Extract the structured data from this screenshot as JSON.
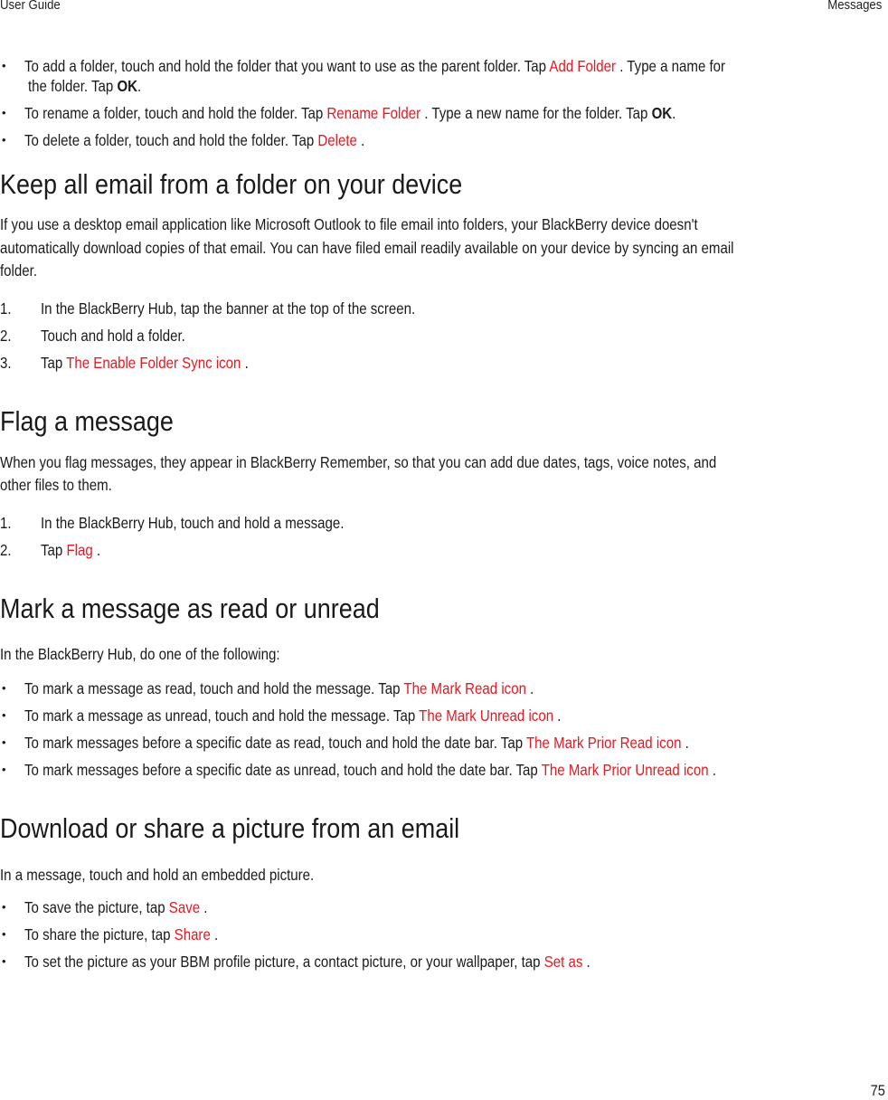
{
  "header": {
    "left": "User Guide",
    "right": "Messages"
  },
  "folder_bullets": [
    {
      "line1_pre": "To add a folder, touch and hold the folder that you want to use as the parent folder. Tap ",
      "link": "Add Folder",
      "line1_post": " . Type a name for",
      "line2_pre": "the folder. Tap ",
      "line2_bold": "OK",
      "line2_post": "."
    },
    {
      "pre": "To rename a folder, touch and hold the folder. Tap ",
      "link": "Rename Folder",
      "post": " . Type a new name for the folder. Tap ",
      "bold": "OK",
      "end": "."
    },
    {
      "pre": "To delete a folder, touch and hold the folder. Tap ",
      "link": "Delete",
      "post": " ."
    }
  ],
  "sections": {
    "keep": {
      "title": "Keep all email from a folder on your device",
      "para": [
        "If you use a desktop email application like Microsoft Outlook to file email into folders, your BlackBerry device doesn't",
        "automatically download copies of that email. You can have filed email readily available on your device by syncing an email",
        "folder."
      ],
      "steps": [
        {
          "num": "1.",
          "text": "In the BlackBerry Hub, tap the banner at the top of the screen."
        },
        {
          "num": "2.",
          "text": "Touch and hold a folder."
        },
        {
          "num": "3.",
          "pre": "Tap ",
          "link": "The Enable Folder Sync icon",
          "post": " ."
        }
      ]
    },
    "flag": {
      "title": "Flag a message",
      "para": [
        "When you flag messages, they appear in BlackBerry Remember, so that you can add due dates, tags, voice notes, and",
        "other files to them."
      ],
      "steps": [
        {
          "num": "1.",
          "text": "In the BlackBerry Hub, touch and hold a message."
        },
        {
          "num": "2.",
          "pre": "Tap ",
          "link": "Flag",
          "post": " ."
        }
      ]
    },
    "mark": {
      "title": "Mark a message as read or unread",
      "intro": "In the BlackBerry Hub, do one of the following:",
      "bullets": [
        {
          "pre": "To mark a message as read, touch and hold the message. Tap ",
          "link": "The Mark Read icon",
          "post": " ."
        },
        {
          "pre": "To mark a message as unread, touch and hold the message. Tap ",
          "link": "The Mark Unread icon",
          "post": " ."
        },
        {
          "pre": "To mark messages before a specific date as read, touch and hold the date bar. Tap ",
          "link": "The Mark Prior Read icon",
          "post": " ."
        },
        {
          "pre": "To mark messages before a specific date as unread, touch and hold the date bar. Tap ",
          "link": "The Mark Prior Unread icon",
          "post": " ."
        }
      ]
    },
    "picture": {
      "title": "Download or share a picture from an email",
      "intro": "In a message, touch and hold an embedded picture.",
      "bullets": [
        {
          "pre": "To save the picture, tap ",
          "link": "Save",
          "post": " ."
        },
        {
          "pre": "To share the picture, tap ",
          "link": "Share",
          "post": " ."
        },
        {
          "pre": "To set the picture as your BBM profile picture, a contact picture, or your wallpaper, tap ",
          "link": "Set as",
          "post": " ."
        }
      ]
    }
  },
  "bullet_glyph": "•",
  "page_number": "75",
  "colors": {
    "link": "#e8171f",
    "text": "#1a1a1a"
  }
}
